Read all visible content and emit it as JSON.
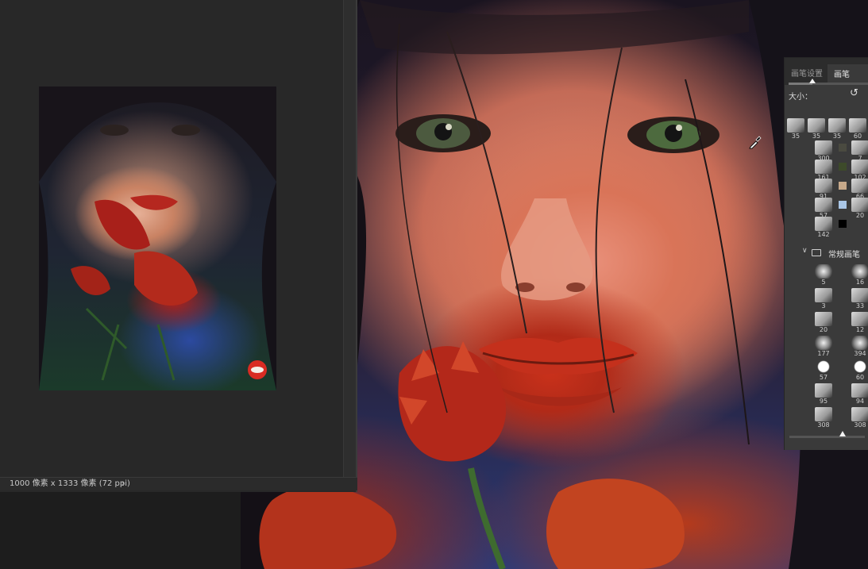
{
  "status_bar": {
    "doc_info": "1000 像素 x 1333 像素 (72 ppi)",
    "arrow": "›"
  },
  "brush_panel": {
    "tabs": [
      {
        "label": "画笔设置",
        "active": false
      },
      {
        "label": "画笔",
        "active": true
      }
    ],
    "size_label": "大小：",
    "reset_icon": "↺",
    "size_slider_level": 0.3,
    "tips_top_row": [
      "35",
      "35",
      "35",
      "60"
    ],
    "tips_grid": [
      {
        "left": "300",
        "right": "7"
      },
      {
        "left": "161",
        "right": "102"
      },
      {
        "left": "91",
        "right": "66"
      },
      {
        "left": "57",
        "right": "20"
      },
      {
        "left": "142",
        "right": ""
      }
    ],
    "swatch_colors": [
      "#4a4a40",
      "#3d4a2a",
      "#c7a98a",
      "#a9c6e6",
      "#000000"
    ],
    "group": {
      "chevron": "∨",
      "label": "常规画笔"
    },
    "group_tips": [
      {
        "left": "5",
        "right": "16"
      },
      {
        "left": "3",
        "right": "33"
      },
      {
        "left": "20",
        "right": "12"
      },
      {
        "left": "177",
        "right": "394"
      },
      {
        "left": "57",
        "right": "60"
      },
      {
        "left": "95",
        "right": "94"
      },
      {
        "left": "308",
        "right": "308"
      }
    ],
    "bottom_slider_level": 0.7
  },
  "colors": {
    "ui_dark": "#282828",
    "panel": "#3a3a3a",
    "lip_red": "#c9311b",
    "skin": "#d97458",
    "blue_fabric": "#2b3a78"
  }
}
